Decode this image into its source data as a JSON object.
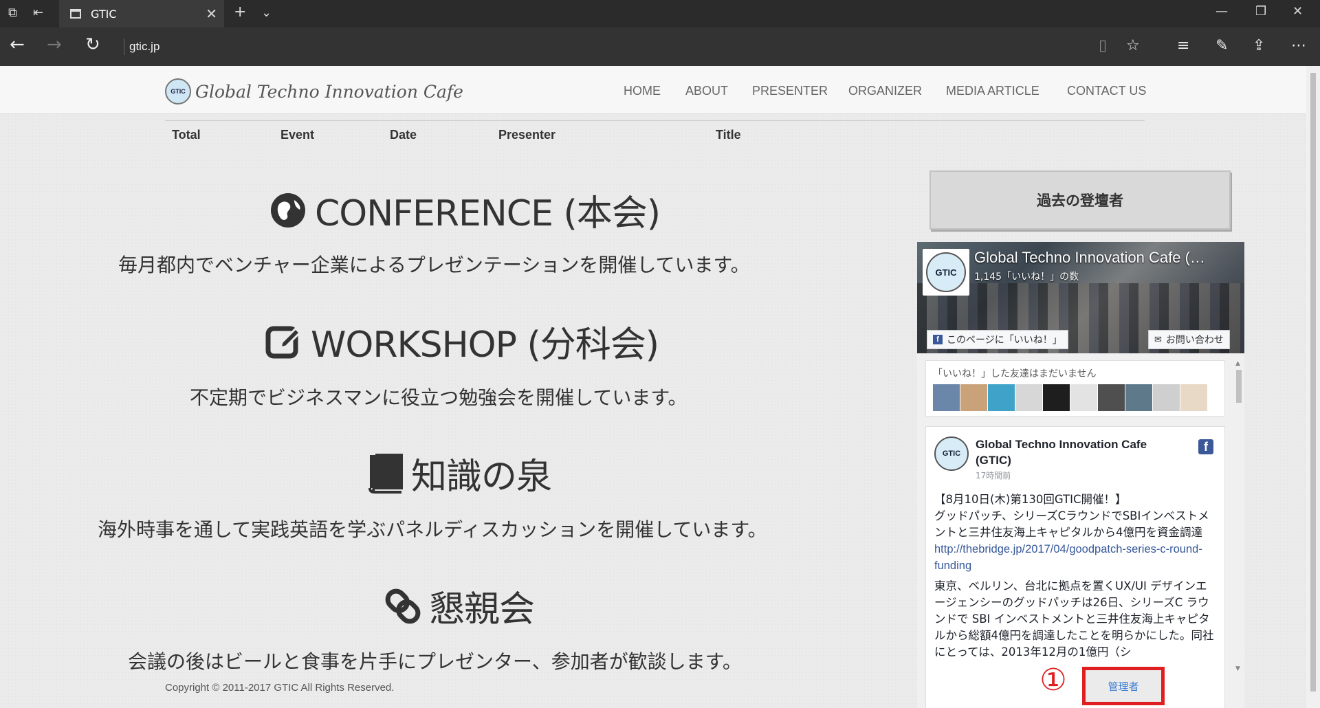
{
  "browser": {
    "tab_title": "GTIC",
    "url": "gtic.jp"
  },
  "header": {
    "logo_seal": "GTIC",
    "logo_text": "Global Techno Innovation Cafe",
    "nav": [
      "HOME",
      "ABOUT",
      "PRESENTER",
      "ORGANIZER",
      "MEDIA ARTICLE",
      "CONTACT US"
    ]
  },
  "table_header": {
    "columns": [
      "Total",
      "Event",
      "Date",
      "Presenter",
      "Title"
    ]
  },
  "sections": [
    {
      "icon": "globe-icon",
      "title": "CONFERENCE (本会)",
      "desc": "毎月都内でベンチャー企業によるプレゼンテーションを開催しています。"
    },
    {
      "icon": "edit-icon",
      "title": "WORKSHOP (分科会)",
      "desc": "不定期でビジネスマンに役立つ勉強会を開催しています。"
    },
    {
      "icon": "book-icon",
      "title": "知識の泉",
      "desc": "海外時事を通して実践英語を学ぶパネルディスカッションを開催しています。"
    },
    {
      "icon": "link-icon",
      "title": "懇親会",
      "desc": "会議の後はビールと食事を片手にプレゼンター、参加者が歓談します。"
    }
  ],
  "sidebar": {
    "past_presenters_button": "過去の登壇者",
    "facebook": {
      "page_name": "Global Techno Innovation Cafe (…",
      "likes": "1,145「いいね！」の数",
      "like_button": "このページに「いいね！」",
      "message_button": "お問い合わせ",
      "friends_label": "「いいね！」した友達はまだいません",
      "post": {
        "author": "Global Techno Innovation Cafe (GTIC)",
        "time": "17時間前",
        "line1": "【8月10日(木)第130回GTIC開催！】",
        "line2": "グッドパッチ、シリーズCラウンドでSBIインベストメントと三井住友海上キャピタルから4億円を資金調達",
        "link": "http://thebridge.jp/2017/04/goodpatch-series-c-round-funding",
        "line3": "東京、ベルリン、台北に拠点を置くUX/UI デザインエージェンシーのグッドパッチは26日、シリーズC ラウンドで SBI インベストメントと三井住友海上キャピタルから総額4億円を調達したことを明らかにした。同社にとっては、2013年12月の1億円（シ"
      }
    }
  },
  "footer": {
    "copyright": "Copyright © 2011-2017 GTIC All Rights Reserved.",
    "admin_link": "管理者",
    "callout": "①"
  },
  "colors": {
    "callout_red": "#e02020",
    "facebook_blue": "#3b5998",
    "link_blue": "#365899"
  }
}
